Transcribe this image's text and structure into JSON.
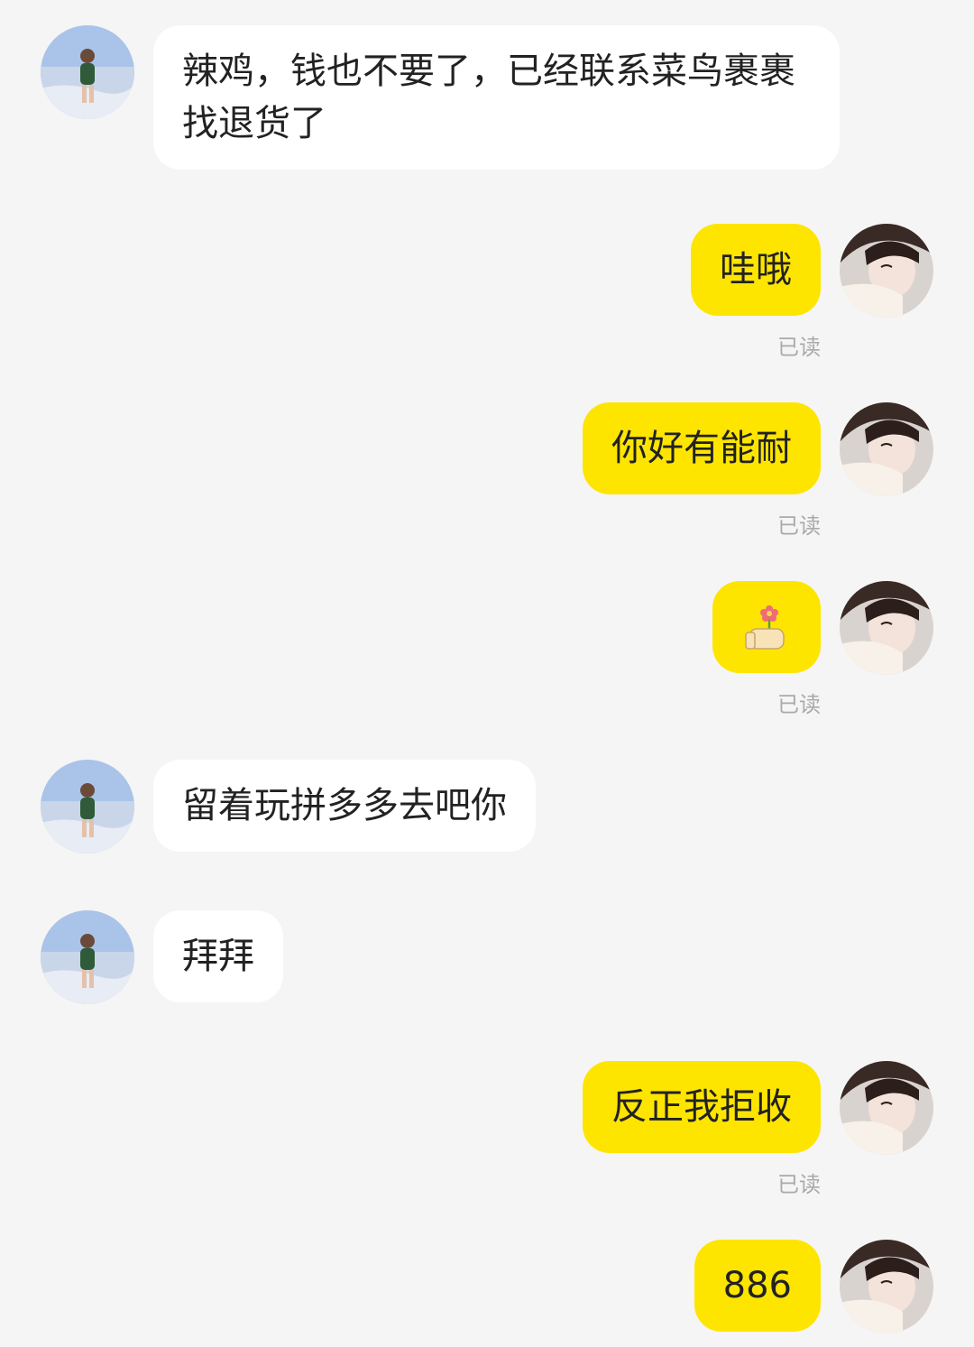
{
  "messages": [
    {
      "side": "in",
      "text": "辣鸡，钱也不要了，已经联系菜鸟裹裹找退货了"
    },
    {
      "side": "out",
      "text": "哇哦",
      "status": "已读"
    },
    {
      "side": "out",
      "text": "你好有能耐",
      "status": "已读"
    },
    {
      "side": "out",
      "emoji": "hand-holding-flower-emoji",
      "status": "已读"
    },
    {
      "side": "in",
      "text": "留着玩拼多多去吧你"
    },
    {
      "side": "in",
      "text": "拜拜"
    },
    {
      "side": "out",
      "text": "反正我拒收",
      "status": "已读"
    },
    {
      "side": "out",
      "text": "886"
    }
  ],
  "colors": {
    "background": "#f5f5f5",
    "incoming_bubble": "#ffffff",
    "outgoing_bubble": "#fee500",
    "read_status": "#aaaaaa"
  }
}
